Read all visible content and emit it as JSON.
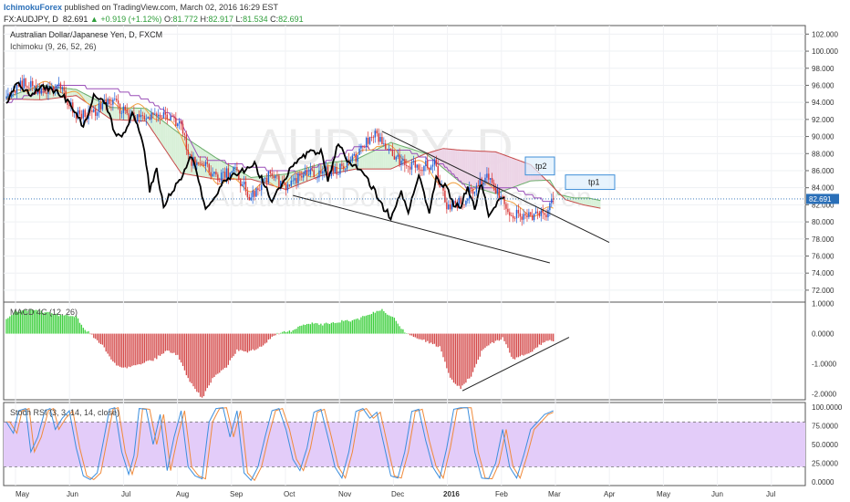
{
  "header": {
    "author": "IchimokuForex",
    "published": "published on TradingView.com, March 02, 2016 16:29 EST",
    "symbol": "FX:AUDJPY, D",
    "last": "82.691",
    "change": "+0.919 (+1.12%)",
    "o_label": "O:",
    "o_value": "81.772",
    "h_label": "H:",
    "h_value": "82.917",
    "l_label": "L:",
    "l_value": "81.534",
    "c_label": "C:",
    "c_value": "82.691"
  },
  "chart_data": [
    {
      "type": "candlestick",
      "title": "Australian Dollar/Japanese Yen, D, FXCM",
      "indicator_label": "Ichimoku (9, 26, 52, 26)",
      "watermark_symbol": "AUDJPY, D",
      "watermark_name": "Australian Dollar/Japanese Yen",
      "ylim": [
        70.6,
        103
      ],
      "y_ticks": [
        "102.000",
        "100.000",
        "98.000",
        "96.000",
        "94.000",
        "92.000",
        "90.000",
        "88.000",
        "86.000",
        "84.000",
        "82.000",
        "80.000",
        "78.000",
        "76.000",
        "74.000",
        "72.000"
      ],
      "y_tick_values": [
        102,
        100,
        98,
        96,
        94,
        92,
        90,
        88,
        86,
        84,
        82,
        80,
        78,
        76,
        74,
        72
      ],
      "last_price_label": "82.691",
      "last_price": 82.69,
      "x_month_labels": [
        "May",
        "Jun",
        "Jul",
        "Aug",
        "Sep",
        "Oct",
        "Nov",
        "Dec",
        "2016",
        "Feb",
        "Mar",
        "Apr",
        "May",
        "Jun",
        "Jul"
      ],
      "price_anchors": [
        [
          0,
          94.5
        ],
        [
          10,
          96.4
        ],
        [
          20,
          95.2
        ],
        [
          30,
          95.8
        ],
        [
          40,
          92.6
        ],
        [
          50,
          92.8
        ],
        [
          60,
          94.2
        ],
        [
          70,
          92.5
        ],
        [
          80,
          92.0
        ],
        [
          90,
          92.6
        ],
        [
          100,
          91.4
        ],
        [
          105,
          87.3
        ],
        [
          112,
          87.0
        ],
        [
          120,
          85.1
        ],
        [
          130,
          86.1
        ],
        [
          140,
          82.8
        ],
        [
          150,
          85.4
        ],
        [
          160,
          84.1
        ],
        [
          170,
          85.4
        ],
        [
          180,
          85.8
        ],
        [
          190,
          86.2
        ],
        [
          200,
          87.6
        ],
        [
          210,
          90.2
        ],
        [
          218,
          89.0
        ],
        [
          225,
          87.2
        ],
        [
          235,
          86.5
        ],
        [
          245,
          86.8
        ],
        [
          252,
          81.6
        ],
        [
          262,
          82.6
        ],
        [
          275,
          85.6
        ],
        [
          282,
          83.0
        ],
        [
          290,
          80.8
        ],
        [
          300,
          80.4
        ],
        [
          310,
          80.9
        ],
        [
          313,
          82.7
        ]
      ],
      "chikou_anchors": [
        [
          0,
          93.6
        ],
        [
          6,
          96.5
        ],
        [
          14,
          94.7
        ],
        [
          20,
          96.0
        ],
        [
          32,
          94.9
        ],
        [
          40,
          92.8
        ],
        [
          44,
          91.0
        ],
        [
          50,
          94.8
        ],
        [
          56,
          94.2
        ],
        [
          62,
          90.6
        ],
        [
          66,
          89.8
        ],
        [
          72,
          92.6
        ],
        [
          78,
          89.6
        ],
        [
          82,
          83.8
        ],
        [
          86,
          86.0
        ],
        [
          90,
          82.0
        ],
        [
          100,
          85.1
        ],
        [
          106,
          87.7
        ],
        [
          110,
          84.8
        ],
        [
          114,
          81.6
        ],
        [
          126,
          85.1
        ],
        [
          136,
          86.1
        ],
        [
          142,
          86.8
        ],
        [
          152,
          82.5
        ],
        [
          162,
          86.1
        ],
        [
          172,
          88.0
        ],
        [
          180,
          88.4
        ],
        [
          184,
          84.9
        ],
        [
          190,
          89.3
        ],
        [
          196,
          86.9
        ],
        [
          202,
          86.3
        ],
        [
          212,
          83.2
        ],
        [
          216,
          81.6
        ],
        [
          220,
          80.6
        ],
        [
          226,
          83.7
        ],
        [
          230,
          80.8
        ],
        [
          236,
          85.8
        ],
        [
          242,
          81.1
        ],
        [
          246,
          85.1
        ],
        [
          252,
          84.0
        ],
        [
          256,
          82.0
        ],
        [
          260,
          81.8
        ],
        [
          264,
          84.2
        ],
        [
          268,
          81.6
        ],
        [
          272,
          84.6
        ],
        [
          276,
          80.6
        ],
        [
          278,
          81.2
        ],
        [
          282,
          82.7
        ],
        [
          285,
          82.6
        ]
      ],
      "cloud_a_anchors": [
        [
          0,
          94.6
        ],
        [
          20,
          96.0
        ],
        [
          40,
          95.5
        ],
        [
          60,
          93.4
        ],
        [
          80,
          93.3
        ],
        [
          100,
          90.2
        ],
        [
          120,
          87.5
        ],
        [
          140,
          85.2
        ],
        [
          160,
          85.6
        ],
        [
          180,
          86.8
        ],
        [
          200,
          87.3
        ],
        [
          220,
          89.3
        ],
        [
          240,
          88.0
        ],
        [
          260,
          84.6
        ],
        [
          280,
          83.3
        ],
        [
          300,
          84.8
        ],
        [
          311,
          84.9
        ],
        [
          316,
          83.2
        ],
        [
          325,
          82.8
        ],
        [
          333,
          82.8
        ],
        [
          340,
          82.5
        ]
      ],
      "cloud_b_anchors": [
        [
          0,
          94.4
        ],
        [
          20,
          94.3
        ],
        [
          40,
          94.8
        ],
        [
          60,
          92.0
        ],
        [
          80,
          91.8
        ],
        [
          100,
          85.7
        ],
        [
          120,
          85.0
        ],
        [
          140,
          85.0
        ],
        [
          160,
          83.8
        ],
        [
          180,
          85.4
        ],
        [
          200,
          86.2
        ],
        [
          220,
          86.2
        ],
        [
          240,
          88.0
        ],
        [
          250,
          88.6
        ],
        [
          260,
          88.4
        ],
        [
          280,
          88.2
        ],
        [
          300,
          86.7
        ],
        [
          310,
          84.7
        ],
        [
          320,
          82.6
        ],
        [
          330,
          82.0
        ],
        [
          340,
          81.6
        ]
      ],
      "kijun_anchors": [
        [
          0,
          94.0
        ],
        [
          30,
          95.9
        ],
        [
          60,
          95.7
        ],
        [
          80,
          94.4
        ],
        [
          100,
          91.8
        ],
        [
          110,
          87.6
        ],
        [
          140,
          86.4
        ],
        [
          170,
          85.7
        ],
        [
          200,
          88.7
        ],
        [
          230,
          88.3
        ],
        [
          250,
          86.6
        ],
        [
          265,
          83.8
        ],
        [
          290,
          84.0
        ],
        [
          305,
          82.7
        ],
        [
          313,
          82.2
        ]
      ],
      "tenkan_anchors": [
        [
          0,
          94.3
        ],
        [
          15,
          96.1
        ],
        [
          30,
          95.8
        ],
        [
          45,
          94.2
        ],
        [
          60,
          93.8
        ],
        [
          75,
          93.4
        ],
        [
          90,
          92.1
        ],
        [
          100,
          90.3
        ],
        [
          110,
          86.4
        ],
        [
          120,
          85.0
        ],
        [
          130,
          84.6
        ],
        [
          140,
          84.0
        ],
        [
          155,
          84.4
        ],
        [
          170,
          85.6
        ],
        [
          185,
          86.1
        ],
        [
          200,
          87.4
        ],
        [
          212,
          89.3
        ],
        [
          225,
          87.9
        ],
        [
          240,
          86.4
        ],
        [
          252,
          84.1
        ],
        [
          265,
          84.1
        ],
        [
          280,
          84.0
        ],
        [
          292,
          81.4
        ],
        [
          305,
          81.0
        ],
        [
          313,
          81.4
        ]
      ],
      "channel_upper": [
        [
          215,
          90.6
        ],
        [
          345,
          77.6
        ]
      ],
      "channel_lower": [
        [
          164,
          83.1
        ],
        [
          311,
          75.2
        ]
      ],
      "annotation_tp2": "tp2",
      "annotation_tp2_price_range": [
        85.5,
        87.6
      ],
      "annotation_tp1": "tp1",
      "annotation_tp1_price_range": [
        83.8,
        85.5
      ],
      "last_bar_index": 313
    },
    {
      "type": "bar",
      "title": "MACD 4C (12, 26)",
      "ylim": [
        -2.2,
        1.05
      ],
      "y_ticks": [
        "1.0000",
        "0.0000",
        "-1.0000",
        "-2.0000"
      ],
      "y_tick_values": [
        1,
        0,
        -1,
        -2
      ],
      "anchors": [
        [
          0,
          0.5
        ],
        [
          5,
          0.75
        ],
        [
          15,
          0.8
        ],
        [
          30,
          0.62
        ],
        [
          40,
          0.55
        ],
        [
          45,
          0.15
        ],
        [
          48,
          0
        ],
        [
          55,
          -0.4
        ],
        [
          62,
          -1.0
        ],
        [
          68,
          -1.15
        ],
        [
          75,
          -1.05
        ],
        [
          85,
          -0.85
        ],
        [
          92,
          -0.55
        ],
        [
          98,
          -0.7
        ],
        [
          104,
          -1.5
        ],
        [
          112,
          -2.15
        ],
        [
          118,
          -1.5
        ],
        [
          126,
          -1.1
        ],
        [
          132,
          -0.55
        ],
        [
          138,
          -0.6
        ],
        [
          146,
          -0.45
        ],
        [
          152,
          -0.08
        ],
        [
          158,
          0.05
        ],
        [
          164,
          0.1
        ],
        [
          172,
          0.35
        ],
        [
          180,
          0.3
        ],
        [
          190,
          0.4
        ],
        [
          200,
          0.45
        ],
        [
          210,
          0.7
        ],
        [
          215,
          0.78
        ],
        [
          222,
          0.5
        ],
        [
          228,
          0.05
        ],
        [
          232,
          -0.1
        ],
        [
          240,
          -0.25
        ],
        [
          248,
          -0.45
        ],
        [
          254,
          -1.5
        ],
        [
          260,
          -1.8
        ],
        [
          266,
          -1.4
        ],
        [
          272,
          -0.6
        ],
        [
          278,
          -0.3
        ],
        [
          284,
          -0.15
        ],
        [
          290,
          -0.85
        ],
        [
          296,
          -0.7
        ],
        [
          302,
          -0.55
        ],
        [
          308,
          -0.25
        ],
        [
          313,
          -0.25
        ]
      ],
      "trendline": [
        [
          261,
          -1.9
        ],
        [
          322,
          -0.12
        ]
      ],
      "positive_color": "#3ccf3c",
      "negative_color": "#d44a4a"
    },
    {
      "type": "line",
      "title": "Stoch RSI (3, 3, 14, 14, close)",
      "ylim": [
        -5,
        106
      ],
      "y_ticks": [
        "100.0000",
        "75.0000",
        "50.0000",
        "25.0000",
        "0.0000"
      ],
      "y_tick_values": [
        100,
        75,
        50,
        25,
        0
      ],
      "band": [
        20,
        80
      ],
      "band_color": "#e3ccf9",
      "k_color": "#3b8ede",
      "d_color": "#f08a3a",
      "k_anchors": [
        [
          0,
          80
        ],
        [
          4,
          65
        ],
        [
          7,
          95
        ],
        [
          11,
          98
        ],
        [
          14,
          40
        ],
        [
          18,
          60
        ],
        [
          22,
          95
        ],
        [
          25,
          98
        ],
        [
          28,
          70
        ],
        [
          32,
          85
        ],
        [
          36,
          95
        ],
        [
          40,
          45
        ],
        [
          44,
          8
        ],
        [
          48,
          3
        ],
        [
          52,
          12
        ],
        [
          56,
          60
        ],
        [
          59,
          97
        ],
        [
          62,
          99
        ],
        [
          66,
          40
        ],
        [
          70,
          10
        ],
        [
          73,
          35
        ],
        [
          76,
          98
        ],
        [
          80,
          97
        ],
        [
          84,
          50
        ],
        [
          88,
          90
        ],
        [
          92,
          15
        ],
        [
          96,
          60
        ],
        [
          100,
          95
        ],
        [
          104,
          20
        ],
        [
          108,
          8
        ],
        [
          112,
          4
        ],
        [
          116,
          80
        ],
        [
          120,
          98
        ],
        [
          124,
          99
        ],
        [
          128,
          60
        ],
        [
          132,
          95
        ],
        [
          136,
          12
        ],
        [
          140,
          2
        ],
        [
          144,
          20
        ],
        [
          148,
          60
        ],
        [
          152,
          95
        ],
        [
          156,
          98
        ],
        [
          160,
          70
        ],
        [
          164,
          30
        ],
        [
          168,
          15
        ],
        [
          172,
          45
        ],
        [
          176,
          93
        ],
        [
          180,
          97
        ],
        [
          184,
          60
        ],
        [
          188,
          20
        ],
        [
          192,
          5
        ],
        [
          196,
          40
        ],
        [
          200,
          94
        ],
        [
          204,
          98
        ],
        [
          208,
          85
        ],
        [
          212,
          93
        ],
        [
          216,
          50
        ],
        [
          220,
          8
        ],
        [
          224,
          5
        ],
        [
          228,
          40
        ],
        [
          232,
          94
        ],
        [
          236,
          97
        ],
        [
          240,
          55
        ],
        [
          244,
          20
        ],
        [
          248,
          5
        ],
        [
          252,
          45
        ],
        [
          256,
          97
        ],
        [
          260,
          99
        ],
        [
          264,
          99
        ],
        [
          268,
          40
        ],
        [
          272,
          5
        ],
        [
          276,
          4
        ],
        [
          280,
          25
        ],
        [
          284,
          70
        ],
        [
          288,
          20
        ],
        [
          292,
          5
        ],
        [
          296,
          35
        ],
        [
          300,
          70
        ],
        [
          304,
          80
        ],
        [
          308,
          90
        ],
        [
          313,
          95
        ]
      ],
      "d_offset": 2
    }
  ]
}
